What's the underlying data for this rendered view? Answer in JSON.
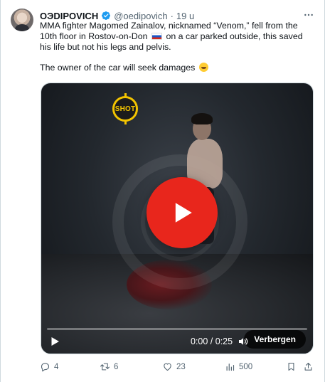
{
  "tweet": {
    "author_name": "ОЭDIPOVICH",
    "handle": "@oedipovich",
    "separator": "·",
    "time": "19 u",
    "text_line_1": "MMA fighter Magomed Zainalov, nicknamed “Venom,” fell from the 10th floor in Rostov-on-Don",
    "text_line_1_rest": "on a car parked outside, this saved his life but not his legs and pelvis.",
    "text_line_2": "The owner of the car will seek damages",
    "icons": {
      "verified": "verified-badge-icon",
      "more": "more-options-icon",
      "flag": "russia-flag-icon",
      "emoji": "laughing-emoji-icon"
    }
  },
  "video": {
    "watermark": "SHOT",
    "time_readout": "0:00 / 0:25",
    "progress": 0.0,
    "hide_label": "Verbergen",
    "colors": {
      "play_button": "#e8261c",
      "watermark": "#f3c400"
    }
  },
  "actions": {
    "replies": "4",
    "reposts": "6",
    "likes": "23",
    "views": "500"
  },
  "colors": {
    "verified": "#1d9bf0",
    "muted_text": "#536471"
  }
}
